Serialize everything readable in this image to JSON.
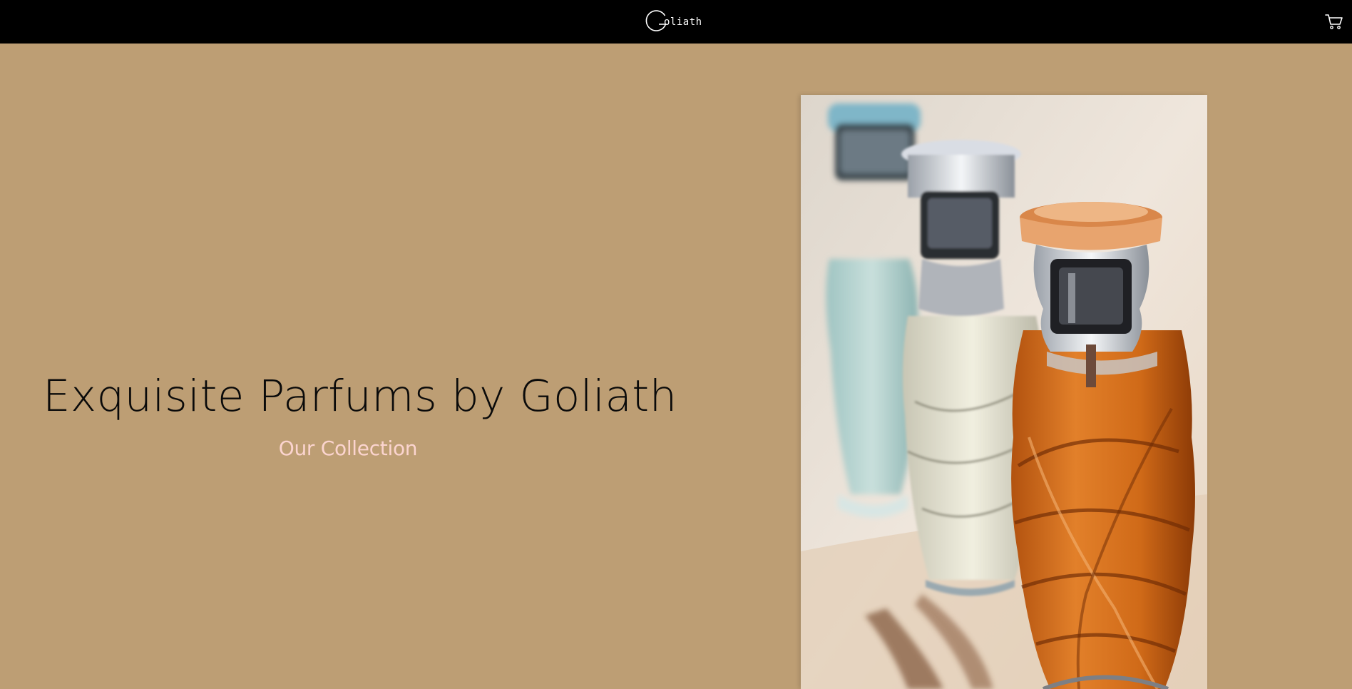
{
  "header": {
    "logo_text": "oliath",
    "logo_alt": "Goliath",
    "cart_icon": "cart-icon"
  },
  "hero": {
    "title": "Exquisite Parfums by Goliath",
    "link_label": "Our Collection"
  },
  "image": {
    "alt": "Perfume bottles"
  },
  "colors": {
    "background": "#bd9e74",
    "header": "#000000",
    "link": "#fbd4cf"
  }
}
